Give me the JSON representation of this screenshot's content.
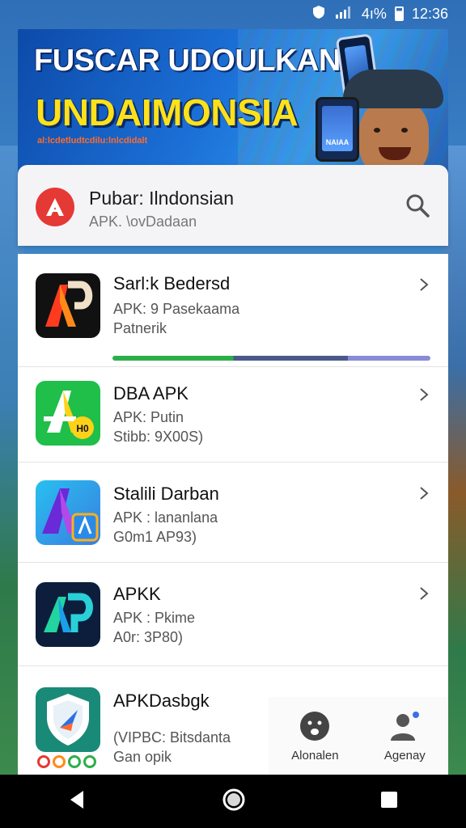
{
  "status_bar": {
    "time": "12:36",
    "signal": "4ı%"
  },
  "banner": {
    "title_line1": "FUSCAR UDOULKAN",
    "title_line2": "UNDAIMONSIA",
    "subtitle": "al:lcdetludtcdilu:lnlcdidalt",
    "phone_label": "NAIAA"
  },
  "search": {
    "title": "Pubar: Ilndonsian",
    "subtitle": "APK. \\ovDadaan"
  },
  "apps": [
    {
      "name": "Sarl:k Bedersd",
      "line1": "APK: 9 Pasekaama",
      "line2": "Patnerik"
    },
    {
      "name": "DBA APK",
      "line1": "APK: Putin",
      "line2": "Stibb: 9X00S)"
    },
    {
      "name": "Stalili Darban",
      "line1": "APK : lananlana",
      "line2": "G0m1 AP93)"
    },
    {
      "name": "APKK",
      "line1": "APK : Pkime",
      "line2": "A0r: 3P80)"
    },
    {
      "name": "APKDasbgk",
      "line1": "",
      "line2": "(VIPBC: Bitsdanta",
      "line3": "Gan opik"
    }
  ],
  "progress": {
    "value": 1.0
  },
  "bottom_actions": [
    {
      "label": "Alonalen",
      "icon": "face-icon"
    },
    {
      "label": "Agenay",
      "icon": "person-icon"
    }
  ],
  "colors": {
    "accent_red": "#e53935",
    "progress_green": "#2eae4a",
    "progress_slate": "#4a5a8a",
    "progress_lilac": "#8a8ad8",
    "banner_yellow": "#ffe11a"
  }
}
